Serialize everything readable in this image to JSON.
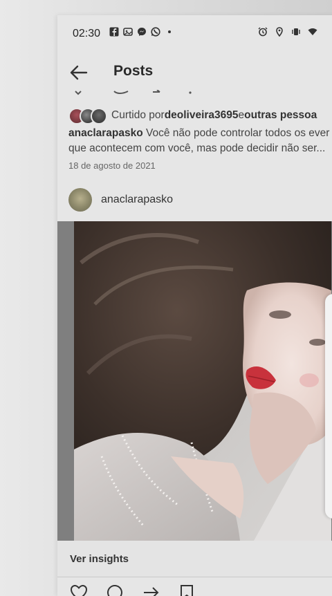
{
  "status_bar": {
    "time": "02:30",
    "left_icons": [
      "facebook-icon",
      "photos-icon",
      "messenger-icon",
      "whatsapp-icon",
      "dot-icon"
    ],
    "right_icons": [
      "alarm-icon",
      "location-icon",
      "vibrate-icon",
      "wifi-icon"
    ]
  },
  "header": {
    "title": "Posts"
  },
  "likes": {
    "prefix": "Curtido por ",
    "user": "deoliveira3695",
    "joiner": " e ",
    "others": "outras pessoa"
  },
  "caption": {
    "user": "anaclarapasko",
    "line1": " Você não pode controlar todos os ever",
    "line2": "que acontecem com você, mas pode decidir não ser..."
  },
  "post_date": "18 de agosto de 2021",
  "author": {
    "name": "anaclarapasko"
  },
  "insights": {
    "label": "Ver insights"
  },
  "colors": {
    "background": "#e6e6e6",
    "text": "#333333",
    "lips": "#c8323c"
  }
}
